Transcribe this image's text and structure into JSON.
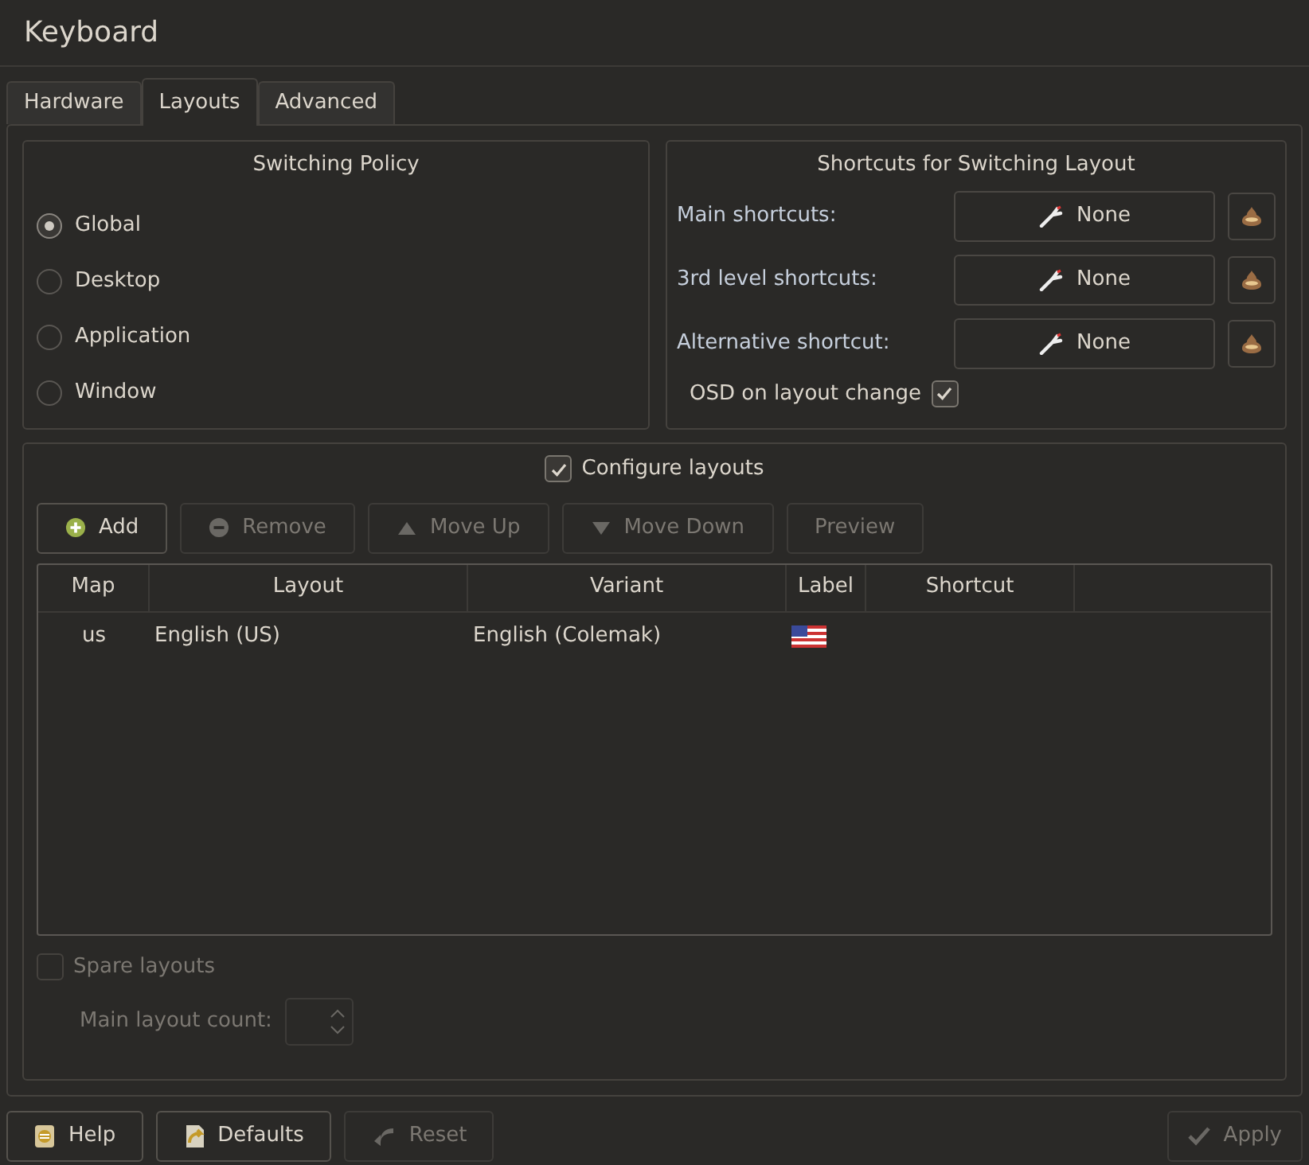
{
  "window": {
    "title": "Keyboard"
  },
  "tabs": [
    {
      "label": "Hardware",
      "selected": false
    },
    {
      "label": "Layouts",
      "selected": true
    },
    {
      "label": "Advanced",
      "selected": false
    }
  ],
  "switching_policy": {
    "title": "Switching Policy",
    "options": [
      {
        "label": "Global",
        "selected": true
      },
      {
        "label": "Desktop",
        "selected": false
      },
      {
        "label": "Application",
        "selected": false
      },
      {
        "label": "Window",
        "selected": false
      }
    ]
  },
  "shortcuts": {
    "title": "Shortcuts for Switching Layout",
    "rows": [
      {
        "label": "Main shortcuts:",
        "value": "None"
      },
      {
        "label": "3rd level shortcuts:",
        "value": "None"
      },
      {
        "label": "Alternative shortcut:",
        "value": "None"
      }
    ],
    "osd": {
      "label": "OSD on layout change",
      "checked": true
    }
  },
  "configure_layouts": {
    "label": "Configure layouts",
    "checked": true
  },
  "toolbar": [
    {
      "label": "Add",
      "kind": "add",
      "disabled": false
    },
    {
      "label": "Remove",
      "kind": "remove",
      "disabled": true
    },
    {
      "label": "Move Up",
      "kind": "up",
      "disabled": true
    },
    {
      "label": "Move Down",
      "kind": "down",
      "disabled": true
    },
    {
      "label": "Preview",
      "kind": "plain",
      "disabled": true
    }
  ],
  "table": {
    "columns": [
      "Map",
      "Layout",
      "Variant",
      "Label",
      "Shortcut"
    ],
    "rows": [
      {
        "map": "us",
        "layout": "English (US)",
        "variant": "English (Colemak)",
        "kind": "flag"
      }
    ]
  },
  "spare_layouts": {
    "label": "Spare layouts",
    "checked": false,
    "disabled": true
  },
  "main_layout_count": {
    "label": "Main layout count:",
    "disabled": true
  },
  "buttons": [
    {
      "label": "Help",
      "kind": "help",
      "disabled": false
    },
    {
      "label": "Defaults",
      "kind": "defaults",
      "disabled": false
    },
    {
      "label": "Reset",
      "kind": "reset",
      "disabled": true
    }
  ],
  "apply": {
    "label": "Apply",
    "disabled": true
  }
}
